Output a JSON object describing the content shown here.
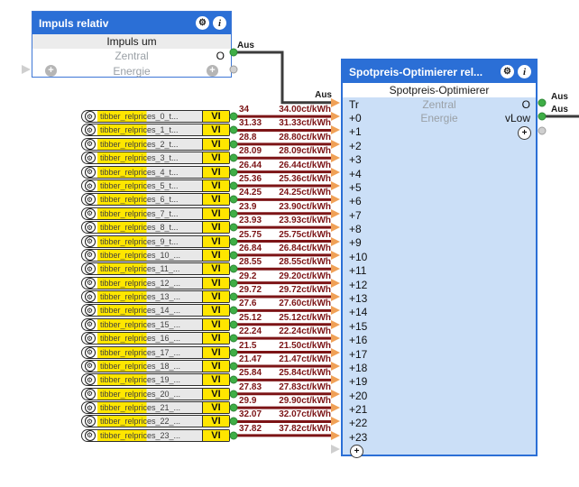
{
  "icons": {
    "gear": "⚙",
    "info": "i",
    "plus": "+"
  },
  "colors": {
    "header_blue": "#2b6fd6",
    "body_blue": "#cbdff7",
    "vi_yellow": "#ffe600",
    "wire_maroon": "#7c1416",
    "wire_black": "#3c3c3c",
    "connector_green": "#3fae46",
    "connector_orange": "#f0a157",
    "connector_gray": "#cfcfcf"
  },
  "impuls_block": {
    "title": "Impuls relativ",
    "subtitle": "Impuls um",
    "row_zentral": {
      "center": "Zentral",
      "output": "O"
    },
    "row_energie": {
      "center": "Energie"
    },
    "output_value": "Aus"
  },
  "spot_block": {
    "title": "Spotpreis-Optimierer rel...",
    "subtitle": "Spotpreis-Optimierer",
    "center_labels": [
      "Zentral",
      "Energie"
    ],
    "outputs": [
      {
        "label": "O",
        "value": "Aus"
      },
      {
        "label": "vLow",
        "value": "Aus"
      }
    ],
    "tr_input_value": "Aus",
    "add_label": "+",
    "inputs": [
      "Tr",
      "+0",
      "+1",
      "+2",
      "+3",
      "+4",
      "+5",
      "+6",
      "+7",
      "+8",
      "+9",
      "+10",
      "+11",
      "+12",
      "+13",
      "+14",
      "+15",
      "+16",
      "+17",
      "+18",
      "+19",
      "+20",
      "+21",
      "+22",
      "+23"
    ]
  },
  "vi_list": {
    "badge": "VI",
    "rows": [
      {
        "label": "tibber_relprices_0_t...",
        "value": "34",
        "formatted": "34.00ct/kWh"
      },
      {
        "label": "tibber_relprices_1_t...",
        "value": "31.33",
        "formatted": "31.33ct/kWh"
      },
      {
        "label": "tibber_relprices_2_t...",
        "value": "28.8",
        "formatted": "28.80ct/kWh"
      },
      {
        "label": "tibber_relprices_3_t...",
        "value": "28.09",
        "formatted": "28.09ct/kWh"
      },
      {
        "label": "tibber_relprices_4_t...",
        "value": "26.44",
        "formatted": "26.44ct/kWh"
      },
      {
        "label": "tibber_relprices_5_t...",
        "value": "25.36",
        "formatted": "25.36ct/kWh"
      },
      {
        "label": "tibber_relprices_6_t...",
        "value": "24.25",
        "formatted": "24.25ct/kWh"
      },
      {
        "label": "tibber_relprices_7_t...",
        "value": "23.9",
        "formatted": "23.90ct/kWh"
      },
      {
        "label": "tibber_relprices_8_t...",
        "value": "23.93",
        "formatted": "23.93ct/kWh"
      },
      {
        "label": "tibber_relprices_9_t...",
        "value": "25.75",
        "formatted": "25.75ct/kWh"
      },
      {
        "label": "tibber_relprices_10_...",
        "value": "26.84",
        "formatted": "26.84ct/kWh"
      },
      {
        "label": "tibber_relprices_11_...",
        "value": "28.55",
        "formatted": "28.55ct/kWh"
      },
      {
        "label": "tibber_relprices_12_...",
        "value": "29.2",
        "formatted": "29.20ct/kWh"
      },
      {
        "label": "tibber_relprices_13_...",
        "value": "29.72",
        "formatted": "29.72ct/kWh"
      },
      {
        "label": "tibber_relprices_14_...",
        "value": "27.6",
        "formatted": "27.60ct/kWh"
      },
      {
        "label": "tibber_relprices_15_...",
        "value": "25.12",
        "formatted": "25.12ct/kWh"
      },
      {
        "label": "tibber_relprices_16_...",
        "value": "22.24",
        "formatted": "22.24ct/kWh"
      },
      {
        "label": "tibber_relprices_17_...",
        "value": "21.5",
        "formatted": "21.50ct/kWh"
      },
      {
        "label": "tibber_relprices_18_...",
        "value": "21.47",
        "formatted": "21.47ct/kWh"
      },
      {
        "label": "tibber_relprices_19_...",
        "value": "25.84",
        "formatted": "25.84ct/kWh"
      },
      {
        "label": "tibber_relprices_20_...",
        "value": "27.83",
        "formatted": "27.83ct/kWh"
      },
      {
        "label": "tibber_relprices_21_...",
        "value": "29.9",
        "formatted": "29.90ct/kWh"
      },
      {
        "label": "tibber_relprices_22_...",
        "value": "32.07",
        "formatted": "32.07ct/kWh"
      },
      {
        "label": "tibber_relprices_23_...",
        "value": "37.82",
        "formatted": "37.82ct/kWh"
      }
    ]
  }
}
